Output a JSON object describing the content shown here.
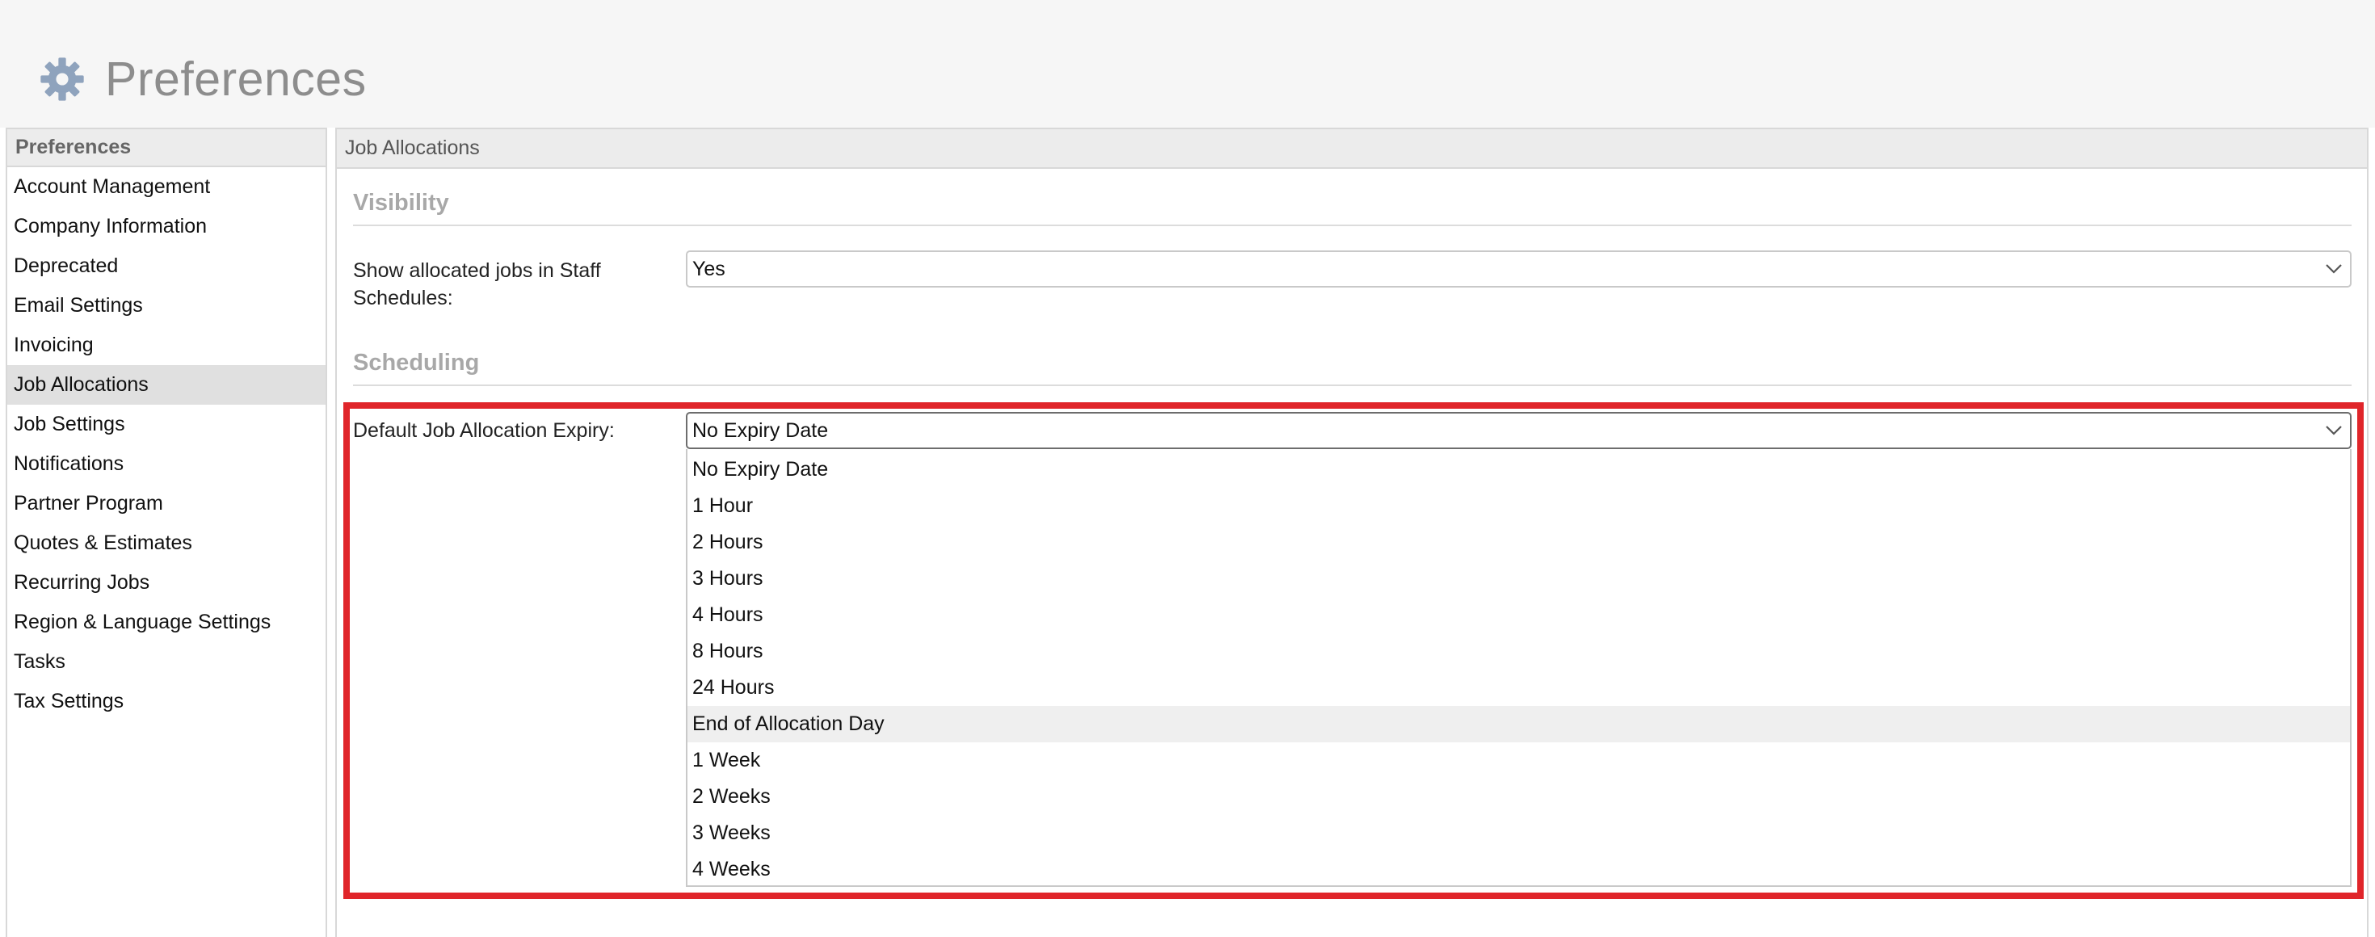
{
  "page": {
    "title": "Preferences",
    "icon": "gear-icon"
  },
  "sidebar": {
    "header": "Preferences",
    "items": [
      {
        "label": "Account Management"
      },
      {
        "label": "Company Information"
      },
      {
        "label": "Deprecated"
      },
      {
        "label": "Email Settings"
      },
      {
        "label": "Invoicing"
      },
      {
        "label": "Job Allocations",
        "active": true
      },
      {
        "label": "Job Settings"
      },
      {
        "label": "Notifications"
      },
      {
        "label": "Partner Program"
      },
      {
        "label": "Quotes & Estimates"
      },
      {
        "label": "Recurring Jobs"
      },
      {
        "label": "Region & Language Settings"
      },
      {
        "label": "Tasks"
      },
      {
        "label": "Tax Settings"
      }
    ]
  },
  "panel": {
    "header": "Job Allocations",
    "visibility": {
      "title": "Visibility",
      "show_allocated_label": "Show allocated jobs in Staff Schedules:",
      "show_allocated_value": "Yes"
    },
    "scheduling": {
      "title": "Scheduling",
      "expiry_label": "Default Job Allocation Expiry:",
      "expiry_value": "No Expiry Date",
      "expiry_options": [
        "No Expiry Date",
        "1 Hour",
        "2 Hours",
        "3 Hours",
        "4 Hours",
        "8 Hours",
        "24 Hours",
        "End of Allocation Day",
        "1 Week",
        "2 Weeks",
        "3 Weeks",
        "4 Weeks"
      ],
      "hovered_option": "End of Allocation Day"
    }
  },
  "colors": {
    "highlight": "#e0252a",
    "gear": "#8fa3bd",
    "section_title": "#a8a8a8"
  }
}
